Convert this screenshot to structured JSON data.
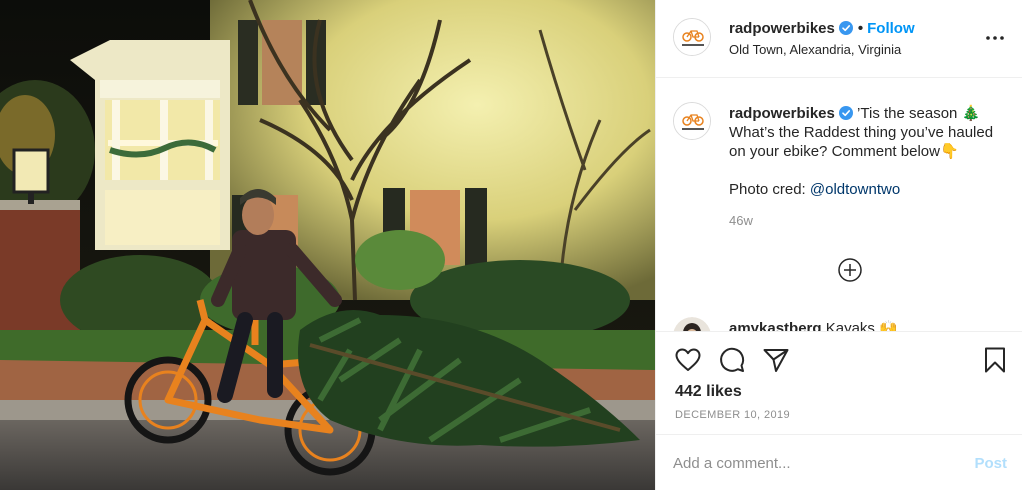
{
  "post": {
    "photo": {
      "alt": ""
    },
    "header": {
      "username": "radpowerbikes",
      "separator": "•",
      "follow_label": "Follow",
      "location": "Old Town, Alexandria, Virginia",
      "avatar_logo_text": "RAD POWER BIKES"
    },
    "caption": {
      "username": "radpowerbikes",
      "line1": "’Tis the season 🎄",
      "line2": "What’s the Raddest thing you’ve hauled",
      "line3": "on your ebike? Comment below👇",
      "credit_prefix": "Photo cred: ",
      "credit_mention": "@oldtowntwo",
      "age": "46w"
    },
    "peek_comment": {
      "username": "amykastberg",
      "text": "Kayaks 🙌"
    },
    "actions": {
      "likes": "442 likes",
      "date": "DECEMBER 10, 2019"
    },
    "comment_box": {
      "placeholder": "Add a comment...",
      "post_label": "Post"
    }
  },
  "icons": {
    "verified": "verified-badge-icon",
    "more": "more-options-icon",
    "load_more": "plus-circle-icon",
    "like": "heart-icon",
    "comment": "comment-bubble-icon",
    "share": "paper-plane-icon",
    "save": "bookmark-icon"
  },
  "colors": {
    "accent": "#0095f6",
    "mention": "#00376b",
    "muted": "#8e8e8e",
    "post_disabled": "#b2dffc",
    "bike_orange": "#e8821e"
  }
}
